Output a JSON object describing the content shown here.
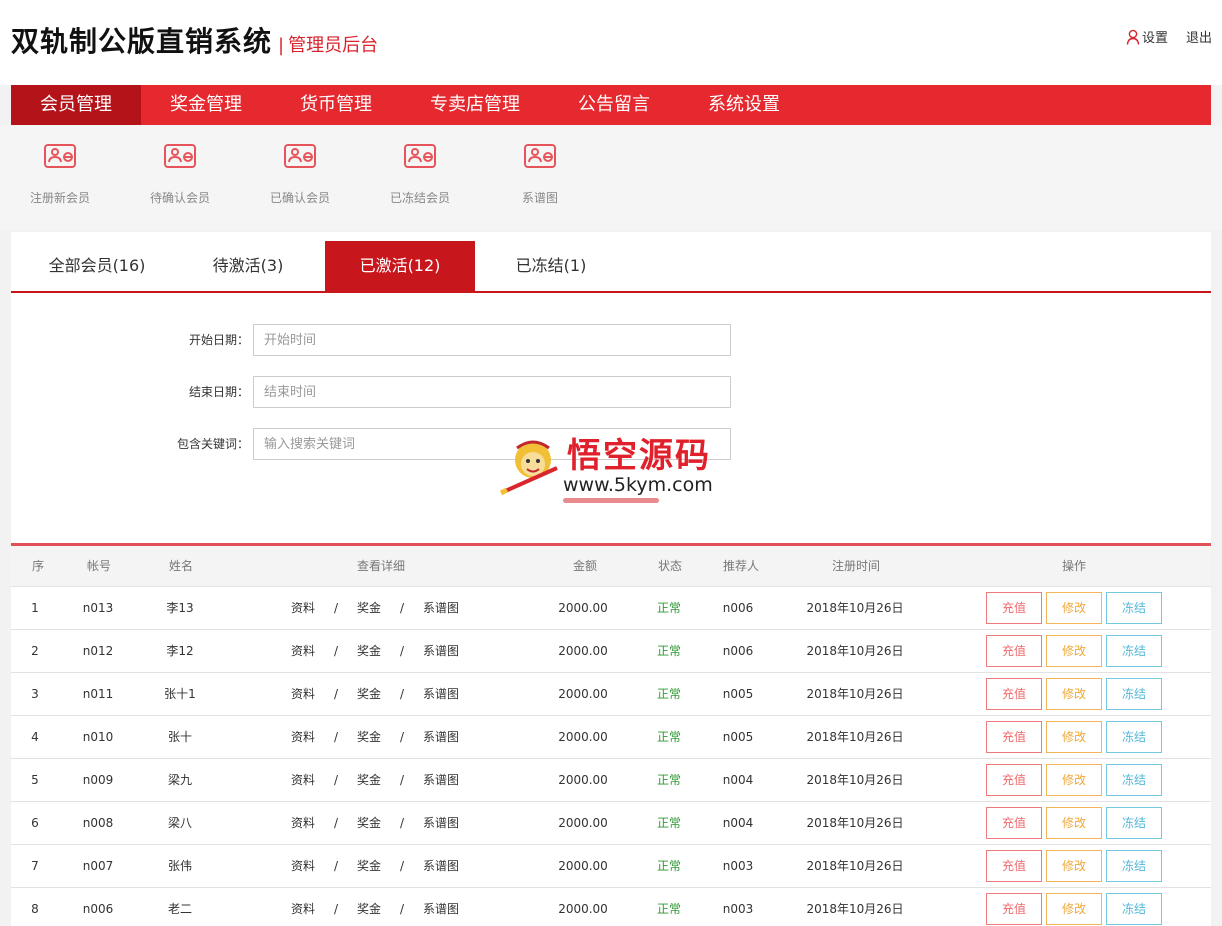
{
  "header": {
    "title": "双轨制公版直销系统",
    "separator": "|",
    "subtitle": "管理员后台",
    "settings_label": "设置",
    "logout_label": "退出"
  },
  "nav": {
    "items": [
      {
        "label": "会员管理"
      },
      {
        "label": "奖金管理"
      },
      {
        "label": "货币管理"
      },
      {
        "label": "专卖店管理"
      },
      {
        "label": "公告留言"
      },
      {
        "label": "系统设置"
      }
    ]
  },
  "subnav": {
    "items": [
      {
        "label": "注册新会员",
        "icon": "member-card-icon"
      },
      {
        "label": "待确认会员",
        "icon": "member-card-icon"
      },
      {
        "label": "已确认会员",
        "icon": "member-card-icon"
      },
      {
        "label": "已冻结会员",
        "icon": "member-card-icon"
      },
      {
        "label": "系谱图",
        "icon": "member-card-icon"
      }
    ]
  },
  "tabs": [
    {
      "label": "全部会员(16)"
    },
    {
      "label": "待激活(3)"
    },
    {
      "label": "已激活(12)"
    },
    {
      "label": "已冻结(1)"
    }
  ],
  "filters": {
    "start_label": "开始日期：",
    "start_placeholder": "开始时间",
    "end_label": "结束日期：",
    "end_placeholder": "结束时间",
    "keyword_label": "包含关键词：",
    "keyword_placeholder": "输入搜索关键词"
  },
  "watermark": {
    "text": "悟空源码",
    "url": "www.5kym.com"
  },
  "table": {
    "headers": {
      "seq": "序",
      "account": "帐号",
      "name": "姓名",
      "detail": "查看详细",
      "amount": "金额",
      "status": "状态",
      "referrer": "推荐人",
      "reg_time": "注册时间",
      "actions": "操作"
    },
    "detail_links": {
      "info": "资料",
      "bonus": "奖金",
      "tree": "系谱图",
      "sep": "/"
    },
    "buttons": {
      "charge": "充值",
      "edit": "修改",
      "freeze": "冻结"
    },
    "rows": [
      {
        "seq": "1",
        "account": "n013",
        "name": "李13",
        "amount": "2000.00",
        "status": "正常",
        "referrer": "n006",
        "reg_time": "2018年10月26日"
      },
      {
        "seq": "2",
        "account": "n012",
        "name": "李12",
        "amount": "2000.00",
        "status": "正常",
        "referrer": "n006",
        "reg_time": "2018年10月26日"
      },
      {
        "seq": "3",
        "account": "n011",
        "name": "张十1",
        "amount": "2000.00",
        "status": "正常",
        "referrer": "n005",
        "reg_time": "2018年10月26日"
      },
      {
        "seq": "4",
        "account": "n010",
        "name": "张十",
        "amount": "2000.00",
        "status": "正常",
        "referrer": "n005",
        "reg_time": "2018年10月26日"
      },
      {
        "seq": "5",
        "account": "n009",
        "name": "梁九",
        "amount": "2000.00",
        "status": "正常",
        "referrer": "n004",
        "reg_time": "2018年10月26日"
      },
      {
        "seq": "6",
        "account": "n008",
        "name": "梁八",
        "amount": "2000.00",
        "status": "正常",
        "referrer": "n004",
        "reg_time": "2018年10月26日"
      },
      {
        "seq": "7",
        "account": "n007",
        "name": "张伟",
        "amount": "2000.00",
        "status": "正常",
        "referrer": "n003",
        "reg_time": "2018年10月26日"
      },
      {
        "seq": "8",
        "account": "n006",
        "name": "老二",
        "amount": "2000.00",
        "status": "正常",
        "referrer": "n003",
        "reg_time": "2018年10月26日"
      }
    ]
  },
  "colors": {
    "brand_red": "#e5292f",
    "active_red": "#c8161d",
    "status_green": "#2f9a33"
  }
}
